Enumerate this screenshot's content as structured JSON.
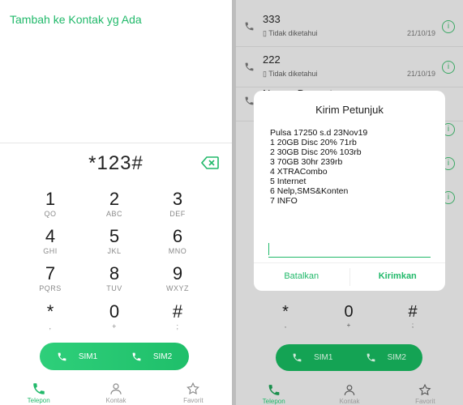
{
  "left": {
    "add_contact": "Tambah ke Kontak yg Ada",
    "dialed": "*123#",
    "keys": [
      {
        "d": "1",
        "l": "QO"
      },
      {
        "d": "2",
        "l": "ABC"
      },
      {
        "d": "3",
        "l": "DEF"
      },
      {
        "d": "4",
        "l": "GHI"
      },
      {
        "d": "5",
        "l": "JKL"
      },
      {
        "d": "6",
        "l": "MNO"
      },
      {
        "d": "7",
        "l": "PQRS"
      },
      {
        "d": "8",
        "l": "TUV"
      },
      {
        "d": "9",
        "l": "WXYZ"
      },
      {
        "d": "*",
        "l": ","
      },
      {
        "d": "0",
        "l": "+"
      },
      {
        "d": "#",
        "l": ";"
      }
    ],
    "sim1": "SIM1",
    "sim2": "SIM2",
    "tabs": [
      "Telepon",
      "Kontak",
      "Favorit"
    ]
  },
  "right": {
    "calls": [
      {
        "number": "333",
        "status": "Tidak diketahui",
        "date": "21/10/19"
      },
      {
        "number": "222",
        "status": "Tidak diketahui",
        "date": "21/10/19"
      },
      {
        "number": "Nomor Darurat",
        "status": "",
        "date": ""
      }
    ],
    "dialog": {
      "title": "Kirim Petunjuk",
      "lines": [
        "Pulsa 17250 s.d 23Nov19",
        "1 20GB Disc 20% 71rb",
        "2 30GB Disc 20% 103rb",
        "3 70GB 30hr 239rb",
        "4 XTRACombo",
        "5 Internet",
        "6 Nelp,SMS&Konten",
        "7 INFO"
      ],
      "cancel": "Batalkan",
      "send": "Kirimkan"
    },
    "keys": [
      {
        "d": "*",
        "l": ","
      },
      {
        "d": "0",
        "l": "+"
      },
      {
        "d": "#",
        "l": ";"
      }
    ],
    "sim1": "SIM1",
    "sim2": "SIM2",
    "tabs": [
      "Telepon",
      "Kontak",
      "Favorit"
    ]
  },
  "colors": {
    "accent": "#21b96a",
    "overlay": "#d6d6d6"
  }
}
